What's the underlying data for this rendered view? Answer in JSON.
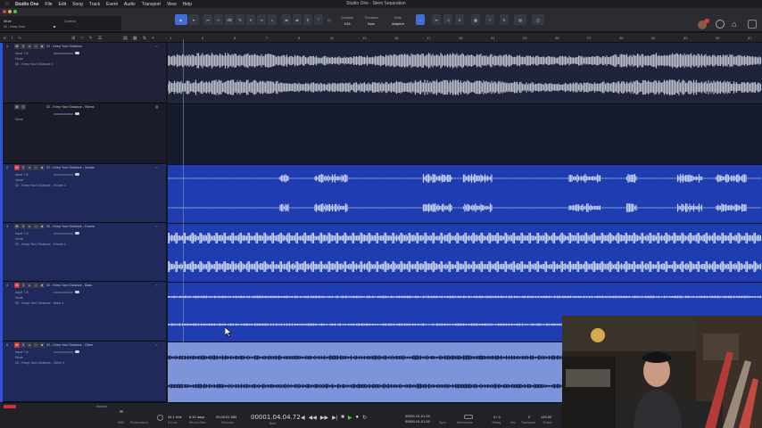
{
  "menu": {
    "app_name": "Studio One",
    "items": [
      "File",
      "Edit",
      "Song",
      "Track",
      "Event",
      "Audio",
      "Transport",
      "View",
      "Help"
    ],
    "document_title": "Studio One - Stem Separation"
  },
  "toolbar": {
    "mute_label": "Mute",
    "control_label": "Control",
    "track_field": "02 - Keep Your",
    "quantize_label": "Quantize",
    "quantize_value": "1/16",
    "timebase_label": "Timebase",
    "timebase_value": "Bars",
    "snap_label": "Snap",
    "snap_value": "Adaptive",
    "iq_label": "IQ"
  },
  "ruler": {
    "bars": [
      "1",
      "3",
      "5",
      "7",
      "9",
      "11",
      "13",
      "15",
      "17",
      "19",
      "21",
      "23",
      "25",
      "27",
      "29",
      "31",
      "33",
      "35",
      "37"
    ]
  },
  "tracks": [
    {
      "num": "1",
      "name": "02 - Keep Your Distance",
      "input": "Input 7-8",
      "none": "None",
      "out": "02 - Keep Your Distance 1",
      "muted": false
    },
    {
      "num": "",
      "name": "02 - Keep Your Distance - Stems",
      "input": "",
      "none": "None",
      "out": "",
      "muted": false
    },
    {
      "num": "2",
      "name": "02 - Keep Your Distance - Vocals",
      "input": "Input 7-8",
      "none": "None",
      "out": "02 - Keep Your Distance - Vocals 1",
      "muted": true
    },
    {
      "num": "3",
      "name": "02 - Keep Your Distance - Drums",
      "input": "Input 7-8",
      "none": "None",
      "out": "02 - Keep Your Distance - Drums 1",
      "muted": false
    },
    {
      "num": "4",
      "name": "02 - Keep Your Distance - Bass",
      "input": "Input 7-8",
      "none": "None",
      "out": "02 - Keep Your Distance - Bass 1",
      "muted": true
    },
    {
      "num": "5",
      "name": "02 - Keep Your Distance - Other",
      "input": "Input 7-8",
      "none": "None",
      "out": "02 - Keep Your Distance - Other 1",
      "muted": true
    }
  ],
  "footer": {
    "normal_label": "Normal",
    "midi_label": "MIDI",
    "performance_label": "Performance",
    "sample_rate": "44.1 kHz",
    "latency": "0.0 ms",
    "record_time": "8:10 days",
    "record_max_label": "Record Max",
    "seconds_value": "00:00:01.985",
    "seconds_label": "Seconds",
    "position": "00001.04.04.72",
    "bars_label": "Bars",
    "loop_start": "00001.01.01.00",
    "loop_end": "00001.01.01.00",
    "sync_label": "Sync",
    "metronome_label": "Metronome",
    "timesig": "4 / 4",
    "timing_label": "Timing",
    "key_label": "Key",
    "transpose": "0",
    "transpose_label": "Transpose",
    "tempo": "120.00",
    "tempo_label": "Tempo"
  },
  "colors": {
    "accent": "#3f6fd0",
    "lane_selected": "#1f3db0",
    "lane_other": "#7e94da",
    "mute_red": "#c8353d",
    "waveform": "#c8d3f5"
  }
}
